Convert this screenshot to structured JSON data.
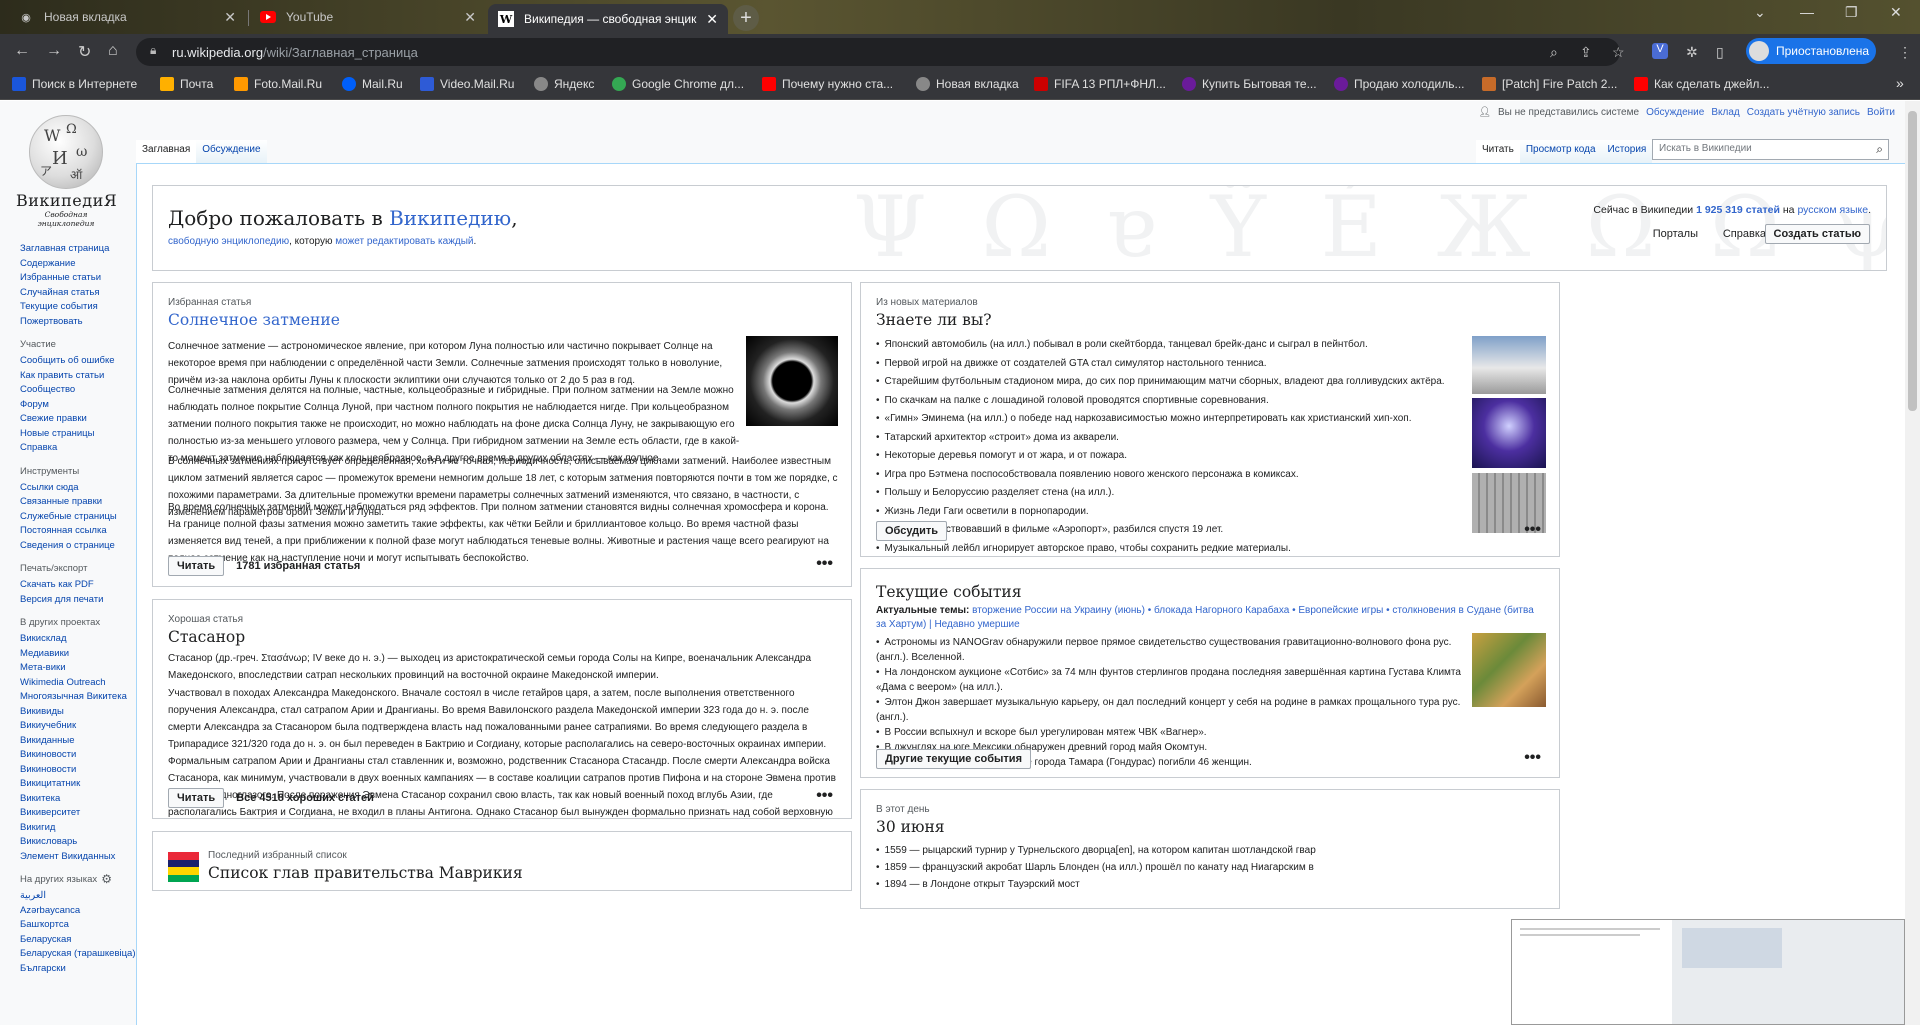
{
  "browser": {
    "tabs": [
      {
        "title": "Новая вкладка",
        "icon": "chrome-icon"
      },
      {
        "title": "YouTube",
        "icon": "youtube-icon"
      },
      {
        "title": "Википедия — свободная энцик",
        "icon": "wikipedia-icon"
      }
    ],
    "url_domain": "ru.wikipedia.org",
    "url_path": "/wiki/Заглавная_страница",
    "profile_label": "Приостановлена",
    "bookmarks": [
      {
        "label": "Поиск в Интернете",
        "color": "#1a56db"
      },
      {
        "label": "Почта",
        "color": "#ffb000"
      },
      {
        "label": "Foto.Mail.Ru",
        "color": "#ff9900"
      },
      {
        "label": "Mail.Ru",
        "color": "#005ff9"
      },
      {
        "label": "Video.Mail.Ru",
        "color": "#2e5bd6"
      },
      {
        "label": "Яндекс",
        "color": "#888888"
      },
      {
        "label": "Google Chrome дл...",
        "color": "#34a853"
      },
      {
        "label": "Почему нужно ста...",
        "color": "#ff0000"
      },
      {
        "label": "Новая вкладка",
        "color": "#888888"
      },
      {
        "label": "FIFA 13 РПЛ+ФНЛ...",
        "color": "#cc0000"
      },
      {
        "label": "Купить Бытовая те...",
        "color": "#6a1b9a"
      },
      {
        "label": "Продаю холодиль...",
        "color": "#6a1b9a"
      },
      {
        "label": "[Patch] Fire Patch 2...",
        "color": "#c76b29"
      },
      {
        "label": "Как сделать джейл...",
        "color": "#ff0000"
      }
    ]
  },
  "wiki": {
    "logo_title": "ВикипедиЯ",
    "logo_subtitle": "Свободная энциклопедия",
    "nav_main": [
      "Заглавная страница",
      "Содержание",
      "Избранные статьи",
      "Случайная статья",
      "Текущие события",
      "Пожертвовать"
    ],
    "nav_participation_h": "Участие",
    "nav_participation": [
      "Сообщить об ошибке",
      "Как править статьи",
      "Сообщество",
      "Форум",
      "Свежие правки",
      "Новые страницы",
      "Справка"
    ],
    "nav_tools_h": "Инструменты",
    "nav_tools": [
      "Ссылки сюда",
      "Связанные правки",
      "Служебные страницы",
      "Постоянная ссылка",
      "Сведения о странице"
    ],
    "nav_print_h": "Печать/экспорт",
    "nav_print": [
      "Скачать как PDF",
      "Версия для печати"
    ],
    "nav_projects_h": "В других проектах",
    "nav_projects": [
      "Викисклад",
      "Медиавики",
      "Мета-вики",
      "Wikimedia Outreach",
      "Многоязычная Викитека",
      "Викивиды",
      "Викиучебник",
      "Викиданные",
      "Викиновости",
      "Викиновости",
      "Викицитатник",
      "Викитека",
      "Викиверситет",
      "Викигид",
      "Викисловарь",
      "Элемент Викиданных"
    ],
    "nav_lang_h": "На других языках",
    "nav_lang": [
      "العربية",
      "Azərbaycanca",
      "Башҡортса",
      "Беларуская",
      "Беларуская (тарашкевіца)",
      "Български"
    ],
    "top_links": {
      "user": "Вы не представились системе",
      "talk": "Обсуждение",
      "contribs": "Вклад",
      "create": "Создать учётную запись",
      "login": "Войти"
    },
    "tabs_left": [
      "Заглавная",
      "Обсуждение"
    ],
    "tabs_right": [
      "Читать",
      "Просмотр кода",
      "История"
    ],
    "search_placeholder": "Искать в Википедии",
    "welcome": {
      "h_pre": "Добро пожаловать в ",
      "h_link": "Википедию",
      "sub1": "свободную энциклопедию",
      "sub2": ", которую ",
      "sub3": "может редактировать каждый",
      "count_pre": "Сейчас в Википедии ",
      "count": "1 925 319 статей",
      "count_mid": " на ",
      "count_lang": "русском языке",
      "portals": "Порталы",
      "help": "Справка",
      "create": "Создать статью"
    },
    "featured": {
      "kicker": "Избранная статья",
      "title": "Солнечное затмение",
      "p1": "Солнечное затмение — астрономическое явление, при котором Луна полностью или частично покрывает Солнце на некоторое время при наблюдении с определённой части Земли. Солнечные затмения происходят только в новолуние, причём из-за наклона орбиты Луны к плоскости эклиптики они случаются только от 2 до 5 раз в год.",
      "p2": "Солнечные затмения делятся на полные, частные, кольцеобразные и гибридные. При полном затмении на Земле можно наблюдать полное покрытие Солнца Луной, при частном полного покрытия не наблюдается нигде. При кольцеобразном затмении полного покрытия также не происходит, но можно наблюдать на фоне диска Солнца Луну, не закрывающую его полностью из-за меньшего углового размера, чем у Солнца. При гибридном затмении на Земле есть области, где в какой-то момент затмение наблюдается как кольцеобразное, а в другое время в других областях — как полное.",
      "p3": "В солнечных затмениях присутствует определённая, хотя и не точная, периодичность, описываемая циклами затмений. Наиболее известным циклом затмений является сарос — промежуток времени немногим дольше 18 лет, с которым затмения повторяются почти в том же порядке, с похожими параметрами. За длительные промежутки времени параметры солнечных затмений изменяются, что связано, в частности, с изменением параметров орбит Земли и Луны.",
      "p4": "Во время солнечных затмений может наблюдаться ряд эффектов. При полном затмении становятся видны солнечная хромосфера и корона. На границе полной фазы затмения можно заметить такие эффекты, как чётки Бейли и бриллиантовое кольцо. Во время частной фазы изменяется вид теней, а при приближении к полной фазе могут наблюдаться теневые волны. Животные и растения чаще всего реагируют на полное затмение как на наступление ночи и могут испытывать беспокойство.",
      "read": "Читать",
      "count": "1781 избранная статья"
    },
    "good": {
      "kicker": "Хорошая статья",
      "title": "Стасанор",
      "p1": "Стасанор (др.-греч. Στασάνωρ; IV веке до н. э.) — выходец из аристократической семьи города Солы на Кипре, военачальник Александра Македонского, впоследствии сатрап нескольких провинций на восточной окраине Македонской империи.",
      "p2": "Участвовал в походах Александра Македонского. Вначале состоял в числе гетайров царя, а затем, после выполнения ответственного поручения Александра, стал сатрапом Арии и Дрангианы. Во время Вавилонского раздела Македонской империи 323 года до н. э. после смерти Александра за Стасанором была подтверждена власть над пожалованными ранее сатрапиями. Во время следующего раздела в Трипарадисе 321/320 года до н. э. он был переведен в Бактрию и Согдиану, которые располагались на северо-восточных окраинах империи. Формальным сатрапом Арии и Дрангианы стал ставленник и, возможно, родственник Стасанора Стасандр. После смерти Александра войска Стасанора, как минимум, участвовали в двух военных кампаниях — в составе коалиции сатрапов против Пифона и на стороне Эвмена против Антигона Одноглазого. После поражения Эвмена Стасанор сохранил свою власть, так как новый военный поход вглубь Азии, где располагались Бактрия и Согдиана, не входил в планы Антигона. Однако Стасанор был вынужден формально признать над собой верховную власть Антигона.",
      "read": "Читать",
      "count": "Все 4518 хороших статей"
    },
    "list": {
      "kicker": "Последний избранный список",
      "title": "Список глав правительства Маврикия"
    },
    "dyk": {
      "kicker": "Из новых материалов",
      "title": "Знаете ли вы?",
      "items": [
        "Японский автомобиль (на илл.) побывал в роли скейтборда, танцевал брейк-данс и сыграл в пейнтбол.",
        "Первой игрой на движке от создателей GTA стал симулятор настольного тенниса.",
        "Старейшим футбольным стадионом мира, до сих пор принимающим матчи сборных, владеют два голливудских актёра.",
        "По скачкам на палке с лошадиной головой проводятся спортивные соревнования.",
        "«Гимн» Эминема (на илл.) о победе над наркозависимостью можно интерпретировать как христианский хип-хоп.",
        "Татарский архитектор «строит» дома из акварели.",
        "Некоторые деревья помогут и от жара, и от пожара.",
        "Игра про Бэтмена поспособствовала появлению нового женского персонажа в комиксах.",
        "Польшу и Белоруссию разделяет стена (на илл.).",
        "Жизнь Леди Гаги осветили в порнопародии.",
        "Самолёт, участвовавший в фильме «Аэропорт», разбился спустя 19 лет.",
        "Музыкальный лейбл игнорирует авторское право, чтобы сохранить редкие материалы."
      ],
      "discuss": "Обсудить"
    },
    "news": {
      "title": "Текущие события",
      "topics_label": "Актуальные темы:",
      "topics": "вторжение России на Украину (июнь) • блокада Нагорного Карабаха • Европейские игры • столкновения в Судане (битва за Хартум) | Недавно умершие",
      "items": [
        "Астрономы из NANOGrav обнаружили первое прямое свидетельство существования гравитационно-волнового фона рус. (англ.). Вселенной.",
        "На лондонском аукционе «Сотбис» за 74 млн фунтов стерлингов продана последняя завершённая картина Густава Климта «Дама с веером» (на илл.).",
        "Элтон Джон завершает музыкальную карьеру, он дал последний концерт у себя на родине в рамках прощального тура рус. (англ.).",
        "В России вспыхнул и вскоре был урегулирован мятеж ЧВК «Вагнер».",
        "В джунглях на юге Мексики обнаружен древний город майя Окомтун.",
        "В ходе бунта в женской тюрьме города Тамара (Гондурас) погибли 46 женщин."
      ],
      "more": "Другие текущие события"
    },
    "otd": {
      "kicker": "В этот день",
      "title": "30 июня",
      "items": [
        "1559 — рыцарский турнир у Турнельского дворца[en], на котором капитан шотландской гвар",
        "1859 — французский акробат Шарль Блонден (на илл.) прошёл по канату над Ниагарским в",
        "1894 — в Лондоне открыт Тауэрский мост"
      ]
    }
  }
}
